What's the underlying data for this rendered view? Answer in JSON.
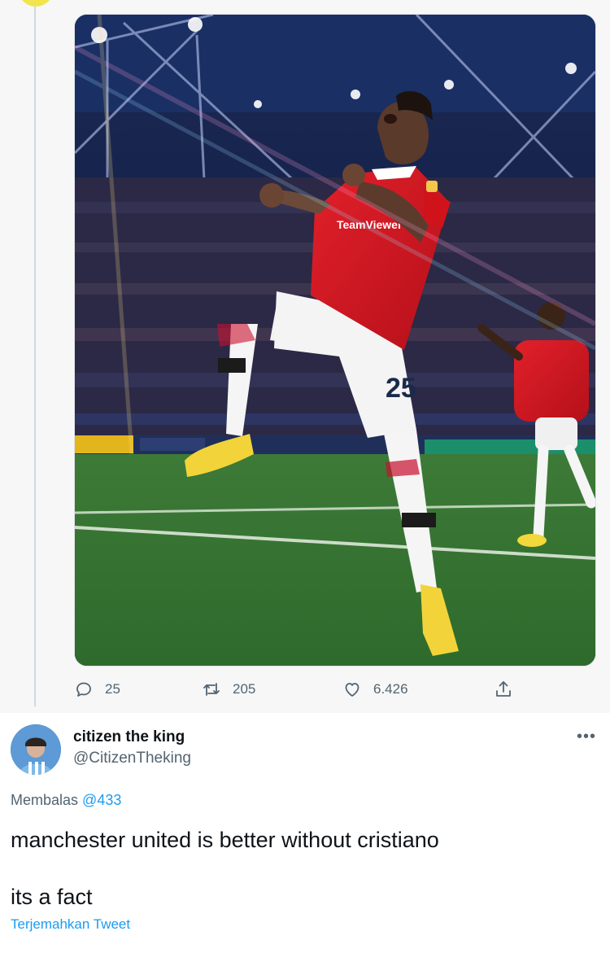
{
  "parent_tweet": {
    "media": {
      "image_label": "tweet-photo",
      "shirt_number": "25",
      "sponsor": "TeamViewer"
    },
    "actions": {
      "reply_count": "25",
      "retweet_count": "205",
      "like_count": "6.426"
    },
    "icons": [
      "reply-icon",
      "retweet-icon",
      "like-icon",
      "share-icon"
    ]
  },
  "reply_tweet": {
    "author": {
      "display_name": "citizen the king",
      "handle": "@CitizenTheking"
    },
    "more_label": "•••",
    "replying": {
      "prefix": "Membalas",
      "mention": "@433"
    },
    "text": {
      "line1": "manchester united is better without cristiano",
      "line2": "its a fact"
    },
    "translate_label": "Terjemahkan Tweet"
  },
  "colors": {
    "accent": "#1d9bf0",
    "muted": "#536471",
    "text": "#0f1419",
    "kit_red": "#d0131b",
    "pitch_green": "#3f7f36"
  }
}
